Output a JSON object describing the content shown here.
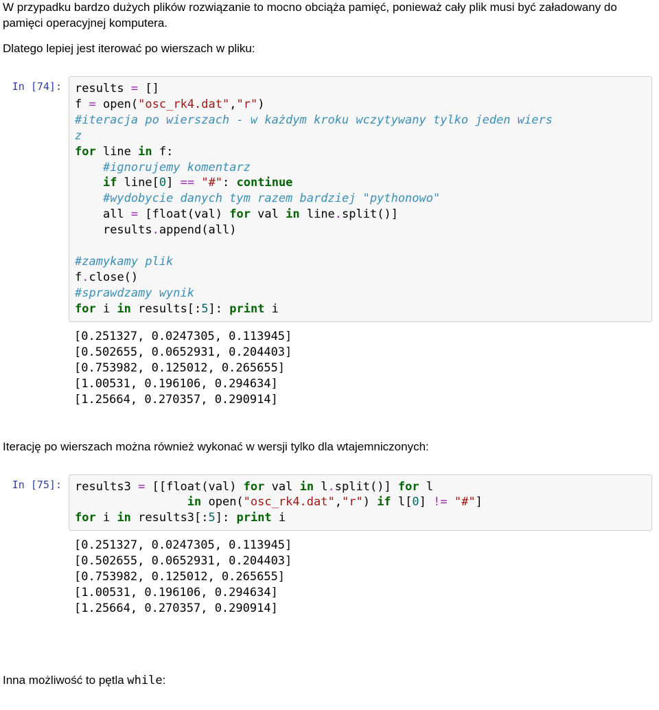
{
  "text": {
    "p1": "W przypadku bardzo dużych plików rozwiązanie to mocno obciąża pamięć, ponieważ cały plik musi być załadowany do pamięci operacyjnej komputera.",
    "p2": "Dlatego lepiej jest iterować po wierszach w pliku:",
    "p3": "Iterację po wierszach można również wykonać w wersji tylko dla wtajemniczonych:",
    "p4_prefix": "Inna możliwość to pętla ",
    "p4_code": "while",
    "p4_suffix": ":"
  },
  "cells": {
    "c74": {
      "prompt": "In [74]:",
      "code": {
        "line1_a": "results ",
        "line1_op": "=",
        "line1_b": " []",
        "line2_a": "f ",
        "line2_op": "=",
        "line2_b": " open(",
        "line2_str": "\"osc_rk4.dat\"",
        "line2_c": ",",
        "line2_str2": "\"r\"",
        "line2_d": ")",
        "line3": "#iteracja po wierszach - w każdym kroku wczytywany tylko jeden wiers",
        "line3b": "z",
        "line4_kw": "for",
        "line4_a": " line ",
        "line4_kw2": "in",
        "line4_b": " f:",
        "line5_indent": "    ",
        "line5": "#ignorujemy komentarz",
        "line6_indent": "    ",
        "line6_kw": "if",
        "line6_a": " line[",
        "line6_num": "0",
        "line6_b": "] ",
        "line6_op": "==",
        "line6_c": " ",
        "line6_str": "\"#\"",
        "line6_d": ": ",
        "line6_kw2": "continue",
        "line7_indent": "    ",
        "line7": "#wydobycie danych tym razem bardziej \"pythonowo\"",
        "line8_indent": "    ",
        "line8_a": "all ",
        "line8_op": "=",
        "line8_b": " [float(val) ",
        "line8_kw": "for",
        "line8_c": " val ",
        "line8_kw2": "in",
        "line8_d": " line",
        "line8_op2": ".",
        "line8_e": "split()]",
        "line9_indent": "    ",
        "line9_a": "results",
        "line9_op": ".",
        "line9_b": "append(all)",
        "line11": "#zamykamy plik",
        "line12_a": "f",
        "line12_op": ".",
        "line12_b": "close()",
        "line13": "#sprawdzamy wynik",
        "line14_kw": "for",
        "line14_a": " i ",
        "line14_kw2": "in",
        "line14_b": " results[:",
        "line14_num": "5",
        "line14_c": "]: ",
        "line14_kw3": "print",
        "line14_d": " i"
      },
      "output": "[0.251327, 0.0247305, 0.113945]\n[0.502655, 0.0652931, 0.204403]\n[0.753982, 0.125012, 0.265655]\n[1.00531, 0.196106, 0.294634]\n[1.25664, 0.270357, 0.290914]"
    },
    "c75": {
      "prompt": "In [75]:",
      "code": {
        "l1_a": "results3 ",
        "l1_op": "=",
        "l1_b": " [[float(val) ",
        "l1_kw": "for",
        "l1_c": " val ",
        "l1_kw2": "in",
        "l1_d": " l",
        "l1_op2": ".",
        "l1_e": "split()] ",
        "l1_kw3": "for",
        "l1_f": " l",
        "l2_indent": "                ",
        "l2_kw": "in",
        "l2_a": " open(",
        "l2_str": "\"osc_rk4.dat\"",
        "l2_b": ",",
        "l2_str2": "\"r\"",
        "l2_c": ") ",
        "l2_kw2": "if",
        "l2_d": " l[",
        "l2_num": "0",
        "l2_e": "] ",
        "l2_op": "!=",
        "l2_f": " ",
        "l2_str3": "\"#\"",
        "l2_g": "]",
        "l3_kw": "for",
        "l3_a": " i ",
        "l3_kw2": "in",
        "l3_b": " results3[:",
        "l3_num": "5",
        "l3_c": "]: ",
        "l3_kw3": "print",
        "l3_d": " i"
      },
      "output": "[0.251327, 0.0247305, 0.113945]\n[0.502655, 0.0652931, 0.204403]\n[0.753982, 0.125012, 0.265655]\n[1.00531, 0.196106, 0.294634]\n[1.25664, 0.270357, 0.290914]"
    }
  }
}
